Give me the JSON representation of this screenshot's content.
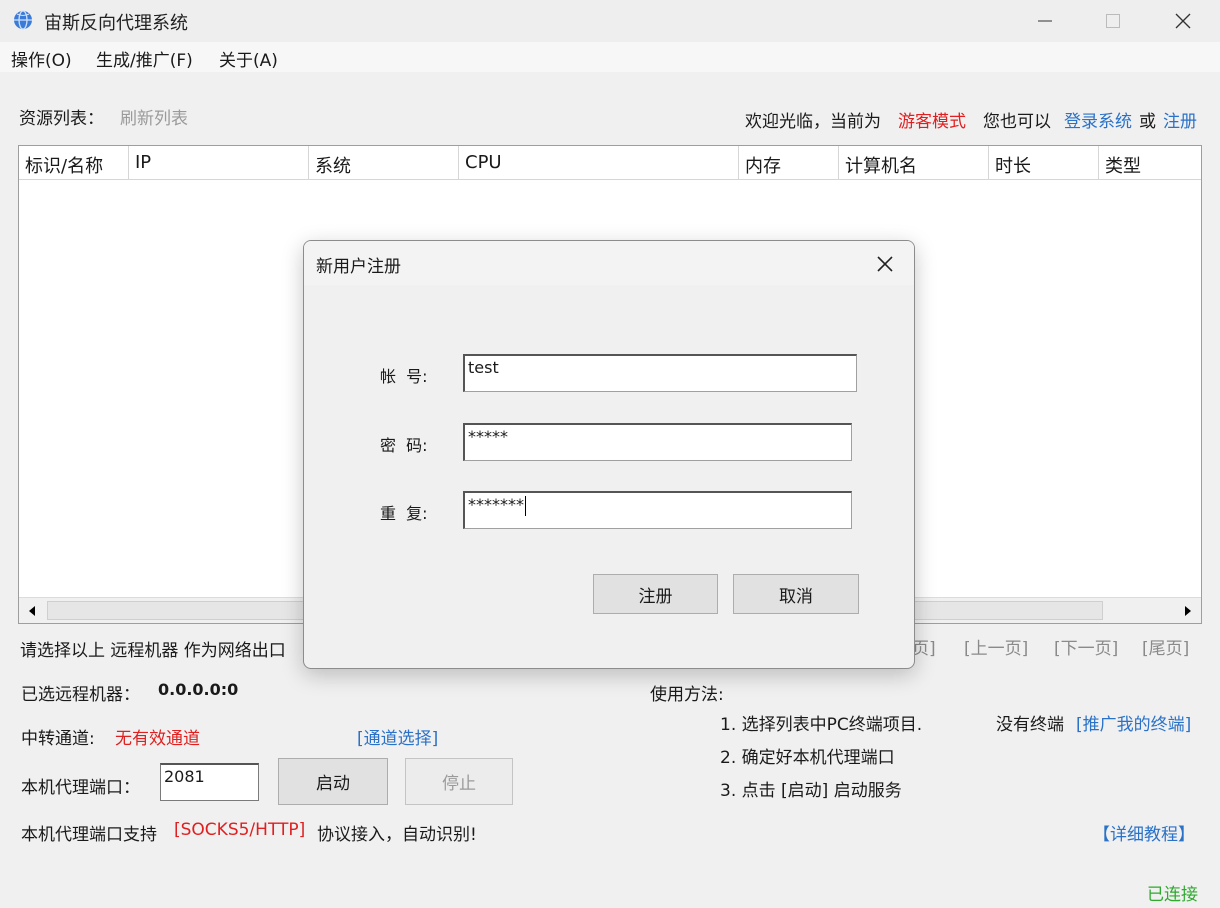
{
  "window": {
    "title": "宙斯反向代理系统"
  },
  "menu": [
    {
      "label": "操作(O)"
    },
    {
      "label": "生成/推广(F)"
    },
    {
      "label": "关于(A)"
    }
  ],
  "header": {
    "resources_label": "资源列表：",
    "refresh": "刷新列表",
    "welcome": "欢迎光临，当前为",
    "mode": "游客模式",
    "also": "您也可以",
    "login": "登录系统",
    "or": "或",
    "register": "注册"
  },
  "table": {
    "columns": [
      "标识/名称",
      "IP",
      "系统",
      "CPU",
      "内存",
      "计算机名",
      "时长",
      "类型"
    ],
    "rows": []
  },
  "bottom": {
    "select_hint": "请选择以上 远程机器 作为网络出口",
    "pager": {
      "first": "页]",
      "prev": "[上一页]",
      "next": "[下一页]",
      "last": "[尾页]"
    },
    "selected_label": "已选远程机器：",
    "selected_value": "0.0.0.0:0",
    "relay_label": "中转通道:",
    "relay_value": "无有效通道",
    "channel_select": "[通道选择]",
    "port_label": "本机代理端口：",
    "port_value": "2081",
    "start": "启动",
    "stop": "停止",
    "support_a": "本机代理端口支持",
    "support_proto": "[SOCKS5/HTTP]",
    "support_b": "协议接入，自动识别!",
    "usage_title": "使用方法:",
    "steps": [
      "1. 选择列表中PC终端项目.",
      "2. 确定好本机代理端口",
      "3. 点击 [启动] 启动服务"
    ],
    "no_terminal": "没有终端",
    "promote": "[推广我的终端]",
    "tutorial": "【详细教程】",
    "status": "已连接"
  },
  "dialog": {
    "title": "新用户注册",
    "account_label": "帐  号:",
    "account_value": "test",
    "password_label": "密  码:",
    "password_value": "*****",
    "repeat_label": "重  复:",
    "repeat_value": "*******",
    "register": "注册",
    "cancel": "取消"
  },
  "colors": {
    "accent": "#2a72c8",
    "warning": "#e02020",
    "success": "#2eaa2e"
  },
  "icons": [
    "globe-icon",
    "minimize-icon",
    "maximize-icon",
    "close-icon",
    "scroll-left-icon",
    "scroll-right-icon"
  ]
}
